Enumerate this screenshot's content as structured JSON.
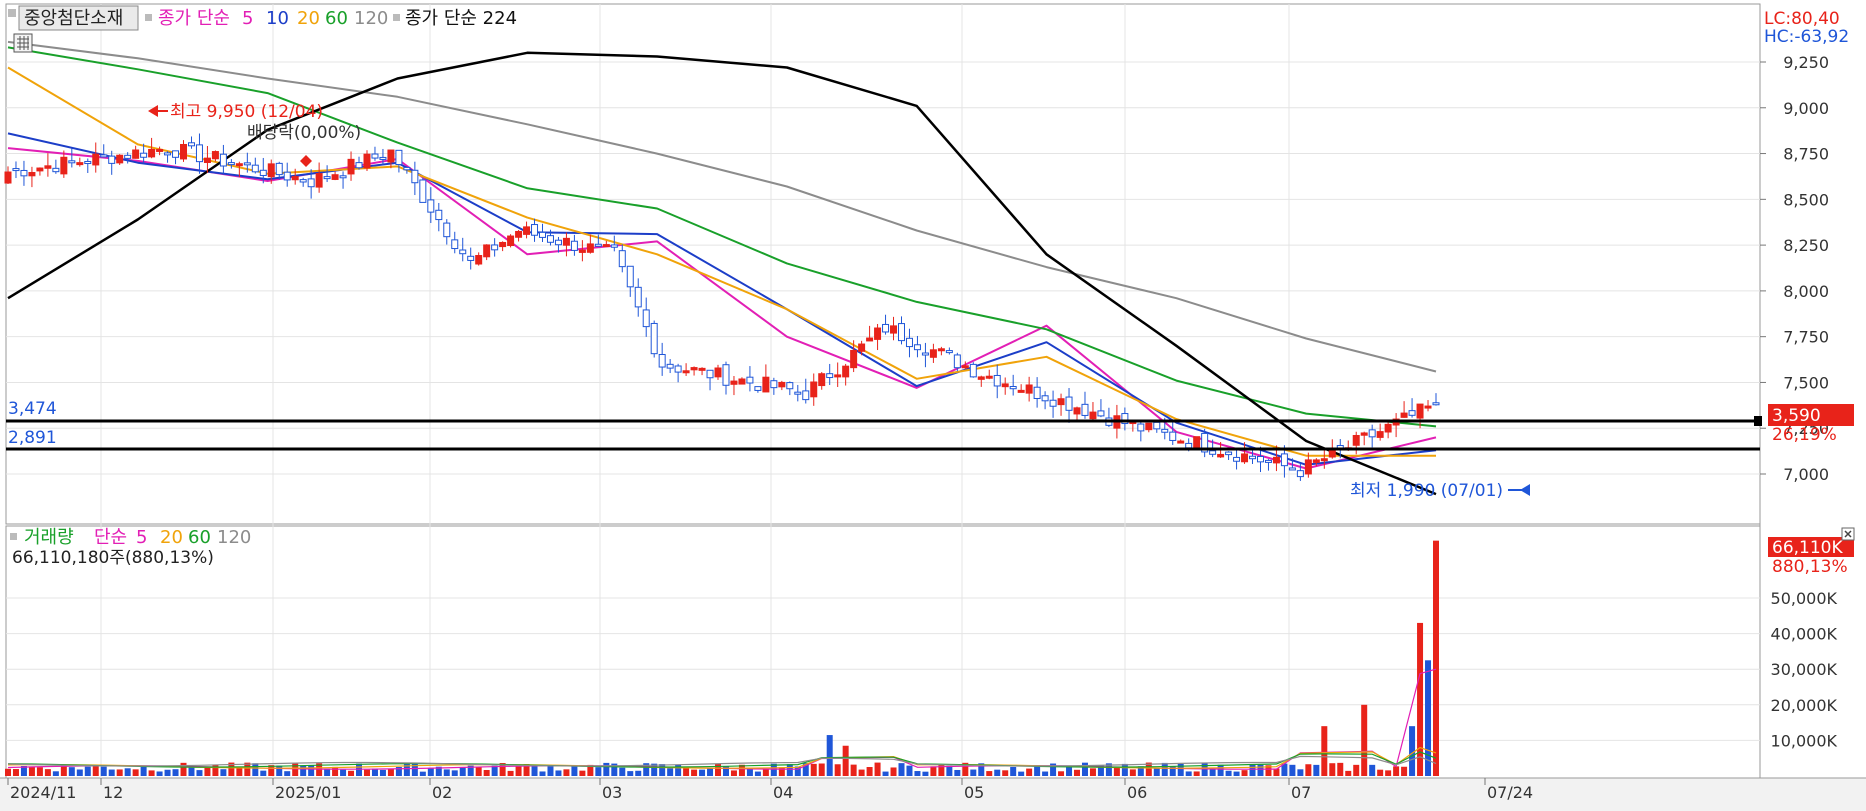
{
  "legend_price": {
    "stock_name": "중앙첨단소재",
    "ma_label": "종가 단순",
    "ma_periods": [
      "5",
      "10",
      "20",
      "60",
      "120"
    ],
    "ma224_label": "종가 단순 224"
  },
  "legend_volume": {
    "label": "거래량",
    "ma_label": "단순",
    "ma_periods": [
      "5",
      "20",
      "60",
      "120"
    ],
    "value_text": "66,110,180주(880,13%)"
  },
  "readouts": {
    "lc": "LC:80,40",
    "hc": "HC:-63,92",
    "price_tag": "3,590",
    "price_pct": "26,19%",
    "vol_tag": "66,110K",
    "vol_pct": "880,13%"
  },
  "annotations": {
    "high": "최고 9,950 (12/04)",
    "dividend": "배당락(0,00%)",
    "low": "최저 1,990 (07/01)",
    "line_a_label": "3,474",
    "line_b_label": "2,891"
  },
  "colors": {
    "up": "#e8231a",
    "down": "#1f56d8",
    "ma5": "#e21fb5",
    "ma10": "#1c3ec8",
    "ma20": "#f0a30a",
    "ma60": "#19a02a",
    "ma120": "#8c8c8c",
    "ma224": "#000000"
  },
  "chart_data": [
    {
      "type": "candlestick",
      "y_ticks": [
        "9,250",
        "9,000",
        "8,750",
        "8,500",
        "8,250",
        "8,000",
        "7,750",
        "7,500",
        "7,250",
        "7,000"
      ],
      "ylim": [
        6900,
        9450
      ],
      "x_labels": [
        "2024/11",
        "12",
        "2025/01",
        "02",
        "03",
        "04",
        "05",
        "06",
        "07",
        "07/24"
      ],
      "ohlc_anchors": [
        {
          "date": "2024/11",
          "close": 8650
        },
        {
          "date": "12/04",
          "close": 8780
        },
        {
          "date": "2025/01",
          "close": 8600
        },
        {
          "date": "01/15",
          "close": 8760
        },
        {
          "date": "02",
          "close": 8150
        },
        {
          "date": "02/20",
          "close": 8330
        },
        {
          "date": "03",
          "close": 8200
        },
        {
          "date": "03/10",
          "close": 7600
        },
        {
          "date": "04",
          "close": 7440
        },
        {
          "date": "04/15",
          "close": 7800
        },
        {
          "date": "05",
          "close": 7550
        },
        {
          "date": "06",
          "close": 7250
        },
        {
          "date": "07",
          "close": 7020
        },
        {
          "date": "07/24",
          "close": 7380
        }
      ],
      "series": [
        {
          "name": "5",
          "values": [
            8780,
            8710,
            8600,
            8720,
            8200,
            8270,
            7750,
            7470,
            7810,
            7230,
            7030,
            7200
          ]
        },
        {
          "name": "10",
          "values": [
            8860,
            8700,
            8610,
            8700,
            8320,
            8310,
            7900,
            7480,
            7720,
            7280,
            7050,
            7130
          ]
        },
        {
          "name": "20",
          "values": [
            9220,
            8800,
            8640,
            8680,
            8400,
            8200,
            7900,
            7520,
            7640,
            7300,
            7100,
            7100
          ]
        },
        {
          "name": "60",
          "values": [
            9330,
            9210,
            9080,
            8810,
            8560,
            8450,
            8150,
            7940,
            7790,
            7510,
            7330,
            7260
          ]
        },
        {
          "name": "120",
          "values": [
            9360,
            9270,
            9160,
            9060,
            8910,
            8750,
            8570,
            8330,
            8130,
            7960,
            7740,
            7560
          ]
        },
        {
          "name": "224",
          "values": [
            7960,
            8390,
            8880,
            9160,
            9300,
            9280,
            9220,
            9010,
            8200,
            7700,
            7180,
            6890
          ]
        }
      ]
    },
    {
      "type": "bar",
      "y_ticks": [
        "50,000K",
        "40,000K",
        "30,000K",
        "20,000K",
        "10,000K"
      ],
      "ylim": [
        0,
        68000
      ],
      "x_labels": [
        "2024/11",
        "12",
        "2025/01",
        "02",
        "03",
        "04",
        "05",
        "06",
        "07",
        "07/24"
      ],
      "notable_bars": [
        {
          "date": "04/15",
          "value": 11500
        },
        {
          "date": "04/17",
          "value": 8500
        },
        {
          "date": "06/24",
          "value": 14000
        },
        {
          "date": "07/04",
          "value": 20000
        },
        {
          "date": "07/18",
          "value": 14000
        },
        {
          "date": "07/21",
          "value": 43000
        },
        {
          "date": "07/22",
          "value": 32500
        },
        {
          "date": "07/24",
          "value": 66110
        }
      ]
    }
  ]
}
